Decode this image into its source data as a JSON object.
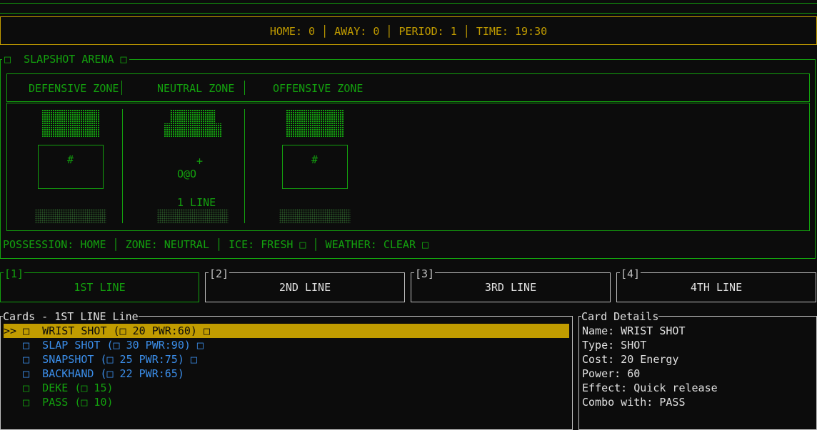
{
  "status": {
    "text": "HOME: 0 │ AWAY: 0 │ PERIOD: 1 │ TIME: 19:30"
  },
  "arena": {
    "title": "□  SLAPSHOT ARENA □",
    "zones": [
      "DEFENSIVE ZONE",
      "NEUTRAL ZONE",
      "OFFENSIVE ZONE"
    ],
    "goal_marker": "#",
    "puck_marker": "+",
    "players": "O@O",
    "line_label": "1 LINE"
  },
  "info_bar": {
    "text": "POSSESSION: HOME │ ZONE: NEUTRAL │ ICE: FRESH □ │ WEATHER: CLEAR □"
  },
  "lines": [
    {
      "num": "[1]",
      "label": "1ST LINE",
      "active": true
    },
    {
      "num": "[2]",
      "label": "2ND LINE",
      "active": false
    },
    {
      "num": "[3]",
      "label": "3RD LINE",
      "active": false
    },
    {
      "num": "[4]",
      "label": "4TH LINE",
      "active": false
    }
  ],
  "cards": {
    "title": "Cards - 1ST LINE Line",
    "items": [
      {
        "text": ">> □  WRIST SHOT (□ 20 PWR:60) □",
        "selected": true
      },
      {
        "text": "   □  SLAP SHOT (□ 30 PWR:90) □",
        "selected": false
      },
      {
        "text": "   □  SNAPSHOT (□ 25 PWR:75) □",
        "selected": false
      },
      {
        "text": "   □  BACKHAND (□ 22 PWR:65)",
        "selected": false
      },
      {
        "text": "   □  DEKE (□ 15)",
        "selected": false
      },
      {
        "text": "   □  PASS (□ 10)",
        "selected": false
      }
    ]
  },
  "details": {
    "title": "Card Details",
    "name": "Name: WRIST SHOT",
    "type": "Type: SHOT",
    "cost": "Cost: 20 Energy",
    "power": "Power: 60",
    "effect": "Effect: Quick release",
    "combo": "Combo with: PASS"
  },
  "colors": {
    "accent_green": "#13a10e",
    "accent_yellow": "#c19c00",
    "card_blue": "#3b8eea",
    "border_grey": "#c0c0c0",
    "background": "#0c0c0c"
  }
}
